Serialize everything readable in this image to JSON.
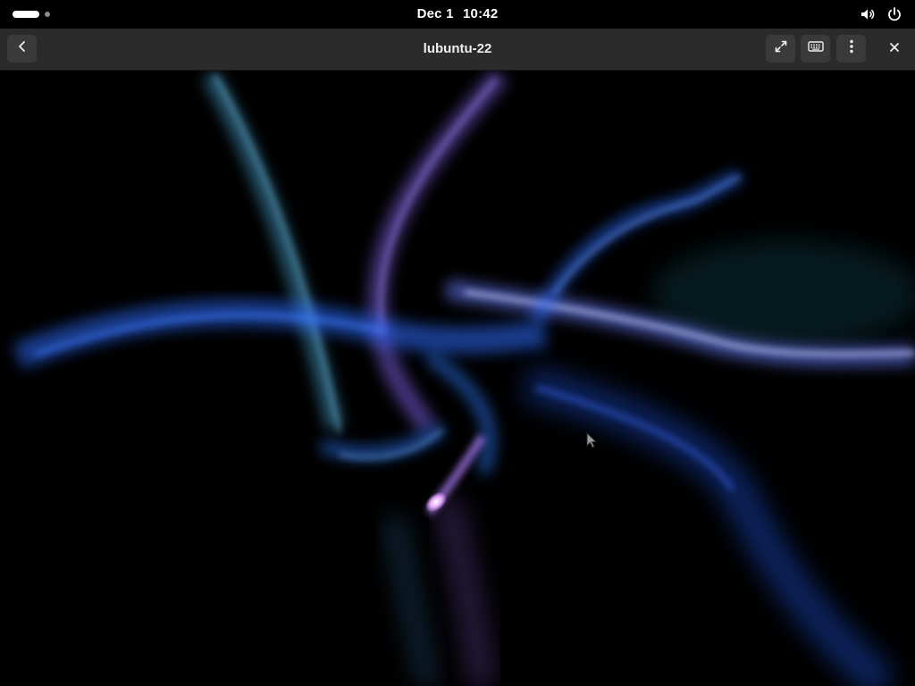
{
  "topbar": {
    "date": "Dec 1",
    "time": "10:42",
    "volume_icon": "volume-icon",
    "power_icon": "power-icon"
  },
  "header": {
    "title": "lubuntu-22",
    "back_icon": "chevron-left-icon",
    "fullscreen_icon": "fullscreen-icon",
    "keyboard_icon": "keyboard-icon",
    "menu_icon": "kebab-menu-icon",
    "close_icon": "close-icon"
  },
  "colors": {
    "topbar_bg": "#000000",
    "header_bg": "#2b2b2b",
    "button_bg": "#3a3a3a",
    "display_bg": "#000000",
    "glow_blue": "#2f6dff",
    "glow_violet": "#8c6cff",
    "glow_cyan": "#4aa8d8"
  }
}
